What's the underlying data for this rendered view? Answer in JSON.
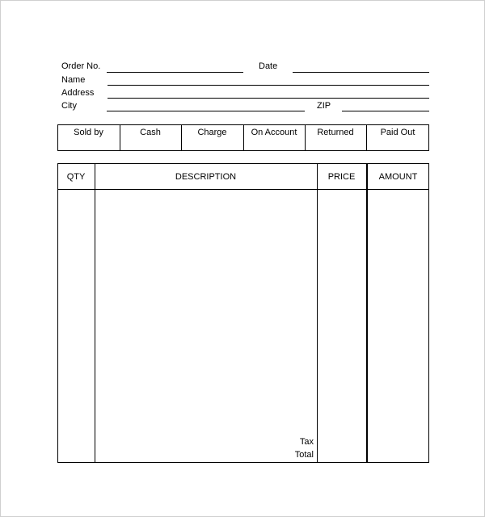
{
  "header_fields": {
    "order_no": "Order No.",
    "date": "Date",
    "name": "Name",
    "address": "Address",
    "city": "City",
    "zip": "ZIP"
  },
  "payment_row": [
    "Sold by",
    "Cash",
    "Charge",
    "On Account",
    "Returned",
    "Paid Out"
  ],
  "items_table": {
    "columns": [
      "QTY",
      "DESCRIPTION",
      "PRICE",
      "AMOUNT"
    ],
    "tax_label": "Tax",
    "total_label": "Total"
  }
}
